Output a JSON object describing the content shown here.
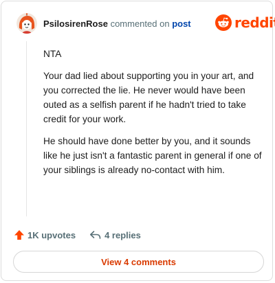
{
  "comment": {
    "username": "PsilosirenRose",
    "action_text": "commented on",
    "post_link": "post",
    "paragraphs": [
      "NTA",
      "Your dad lied about supporting you in your art, and you corrected the lie. He never would have been outed as a selfish parent if he hadn't tried to take credit for your work.",
      "He should have done better by you, and it sounds like he just isn't a fantastic parent in general if one of your siblings is already no-contact with him."
    ]
  },
  "brand": {
    "wordmark": "reddit",
    "color": "#ff4500"
  },
  "actions": {
    "upvotes": "1K upvotes",
    "replies": "4 replies",
    "upvote_icon": "upvote-arrow-icon",
    "reply_icon": "reply-arrow-icon"
  },
  "footer": {
    "view_comments": "View 4 comments"
  },
  "colors": {
    "accent": "#ff4500",
    "link": "#0045ac",
    "muted": "#576f76",
    "view_button_text": "#d93a00"
  }
}
